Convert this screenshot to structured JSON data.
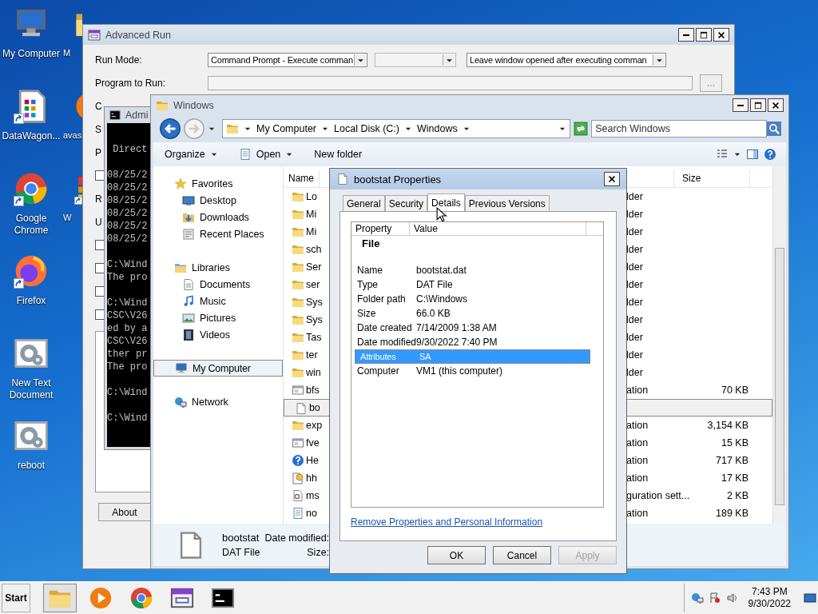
{
  "desktop_icons": [
    {
      "label": "My Computer",
      "kind": "computer",
      "shortcut": false
    },
    {
      "label": "DataWagon...",
      "kind": "grid",
      "shortcut": true
    },
    {
      "label": "Google Chrome",
      "kind": "chrome",
      "shortcut": true
    },
    {
      "label": "Firefox",
      "kind": "firefox",
      "shortcut": true
    },
    {
      "label": "New Text Document",
      "kind": "gear",
      "shortcut": false
    },
    {
      "label": "reboot",
      "kind": "gear",
      "shortcut": false
    }
  ],
  "desktop_icons_partial": [
    {
      "label": "M",
      "kind": "folder",
      "shortcut": false
    },
    {
      "label": "avas",
      "kind": "avast",
      "shortcut": false
    },
    {
      "label": "W",
      "kind": "app",
      "shortcut": true
    }
  ],
  "advanced_run": {
    "title": "Advanced Run",
    "run_mode_label": "Run Mode:",
    "run_mode": "Command Prompt - Execute comman",
    "secondary_mode": {
      "disabled": true
    },
    "window_mode": "Leave window opened after executing comman",
    "program_label": "Program to Run:",
    "browse_button": "...",
    "rows": [
      {
        "kind": "label",
        "text": "C"
      },
      {
        "kind": "label",
        "text": "S"
      },
      {
        "kind": "label",
        "text": "P"
      },
      {
        "kind": "checkbox",
        "checked": false
      },
      {
        "kind": "label",
        "text": "R"
      },
      {
        "kind": "label",
        "text": "U"
      },
      {
        "kind": "checkbox",
        "checked": false
      },
      {
        "kind": "checkbox",
        "checked": false
      },
      {
        "kind": "checkbox",
        "checked": false
      },
      {
        "kind": "checkbox",
        "checked": false
      }
    ],
    "about_button": "About"
  },
  "console": {
    "title": "Admi",
    "blocks": [
      [
        " Direct"
      ],
      [
        "08/25/2",
        "08/25/2",
        "08/25/2",
        "08/25/2",
        "08/25/2",
        "08/25/2"
      ],
      [
        "C:\\Wind",
        "The pro"
      ],
      [
        "C:\\Wind",
        "CSC\\V26",
        "ed by a",
        "CSC\\V26",
        "ther pr",
        "The pro"
      ],
      [
        "C:\\Wind"
      ],
      [
        "C:\\Wind"
      ]
    ]
  },
  "explorer": {
    "title": "Windows",
    "breadcrumb": [
      "My Computer",
      "Local Disk (C:)",
      "Windows"
    ],
    "search": {
      "placeholder": "Search Windows"
    },
    "toolbar": [
      {
        "label": "Organize",
        "dropdown": true
      },
      {
        "label": "Open",
        "dropdown": true
      },
      {
        "label": "New folder",
        "dropdown": false
      }
    ],
    "nav": [
      {
        "label": "Favorites",
        "kind": "star",
        "selected": false,
        "children": [
          {
            "label": "Desktop",
            "kind": "desktop",
            "selected": false
          },
          {
            "label": "Downloads",
            "kind": "downloads",
            "selected": false
          },
          {
            "label": "Recent Places",
            "kind": "recent",
            "selected": false
          }
        ]
      },
      {
        "label": "Libraries",
        "kind": "library",
        "selected": false,
        "children": [
          {
            "label": "Documents",
            "kind": "documents",
            "selected": false
          },
          {
            "label": "Music",
            "kind": "music",
            "selected": false
          },
          {
            "label": "Pictures",
            "kind": "pictures",
            "selected": false
          },
          {
            "label": "Videos",
            "kind": "videos",
            "selected": false
          }
        ]
      },
      {
        "label": "My Computer",
        "kind": "computer",
        "selected": true
      },
      {
        "label": "Network",
        "kind": "network",
        "selected": false
      }
    ],
    "columns": [
      "Name",
      "Size"
    ],
    "files": [
      {
        "name": "Lo",
        "kind": "folder",
        "type": "lder",
        "selected": false
      },
      {
        "name": "Mi",
        "kind": "folder",
        "type": "lder",
        "selected": false
      },
      {
        "name": "Mi",
        "kind": "folder",
        "type": "lder",
        "selected": false
      },
      {
        "name": "sch",
        "kind": "folder",
        "type": "lder",
        "selected": false
      },
      {
        "name": "Ser",
        "kind": "folder",
        "type": "lder",
        "selected": false
      },
      {
        "name": "ser",
        "kind": "folder",
        "type": "lder",
        "selected": false
      },
      {
        "name": "Sys",
        "kind": "folder",
        "type": "lder",
        "selected": false
      },
      {
        "name": "Sys",
        "kind": "folder",
        "type": "lder",
        "selected": false
      },
      {
        "name": "Tas",
        "kind": "folder",
        "type": "lder",
        "selected": false
      },
      {
        "name": "ter",
        "kind": "folder",
        "type": "lder",
        "selected": false
      },
      {
        "name": "win",
        "kind": "folder",
        "type": "lder",
        "selected": false
      },
      {
        "name": "bfs",
        "kind": "exe",
        "type": "ation",
        "size": "70 KB",
        "selected": false
      },
      {
        "name": "bo",
        "kind": "file",
        "selected": true
      },
      {
        "name": "exp",
        "kind": "explorer",
        "type": "ation",
        "size": "3,154 KB",
        "selected": false
      },
      {
        "name": "fve",
        "kind": "exe",
        "type": "ation",
        "size": "15 KB",
        "selected": false
      },
      {
        "name": "He",
        "kind": "help",
        "type": "ation",
        "size": "717 KB",
        "selected": false
      },
      {
        "name": "hh",
        "kind": "hhelp",
        "type": "ation",
        "size": "17 KB",
        "selected": false
      },
      {
        "name": "ms",
        "kind": "config",
        "type": "guration sett...",
        "size": "2 KB",
        "selected": false
      },
      {
        "name": "no",
        "kind": "notepad",
        "type": "ation",
        "size": "189 KB",
        "selected": false
      }
    ],
    "details_pane": {
      "name": "bootstat",
      "type": "DAT File",
      "labels": [
        "Date modified:",
        "Size:"
      ]
    }
  },
  "properties": {
    "title": "bootstat Properties",
    "tabs": [
      {
        "label": "General",
        "selected": false
      },
      {
        "label": "Security",
        "selected": false
      },
      {
        "label": "Details",
        "selected": true
      },
      {
        "label": "Previous Versions",
        "selected": false
      }
    ],
    "columns": [
      "Property",
      "Value"
    ],
    "group": "File",
    "rows": [
      {
        "property": "Name",
        "value": "bootstat.dat",
        "selected": false
      },
      {
        "property": "Type",
        "value": "DAT File",
        "selected": false
      },
      {
        "property": "Folder path",
        "value": "C:\\Windows",
        "selected": false
      },
      {
        "property": "Size",
        "value": "66.0 KB",
        "selected": false
      },
      {
        "property": "Date created",
        "value": "7/14/2009 1:38 AM",
        "selected": false
      },
      {
        "property": "Date modified",
        "value": "9/30/2022 7:40 PM",
        "selected": false
      },
      {
        "property": "Attributes",
        "value": "SA",
        "selected": true
      },
      {
        "property": "Computer",
        "value": "VM1 (this computer)",
        "selected": false
      }
    ],
    "link": "Remove Properties and Personal Information",
    "buttons": [
      {
        "label": "OK",
        "disabled": false
      },
      {
        "label": "Cancel",
        "disabled": false
      },
      {
        "label": "Apply",
        "disabled": true
      }
    ]
  },
  "taskbar": {
    "start": "Start",
    "apps": [
      {
        "kind": "explorer",
        "selected": true
      },
      {
        "kind": "media",
        "selected": false
      },
      {
        "kind": "chrome",
        "selected": false
      },
      {
        "kind": "advrun",
        "selected": false
      },
      {
        "kind": "cmd",
        "selected": false
      }
    ],
    "tray": [
      {
        "kind": "traynet"
      },
      {
        "kind": "flag"
      },
      {
        "kind": "volume"
      }
    ],
    "time": "7:43 PM",
    "date": "9/30/2022"
  }
}
